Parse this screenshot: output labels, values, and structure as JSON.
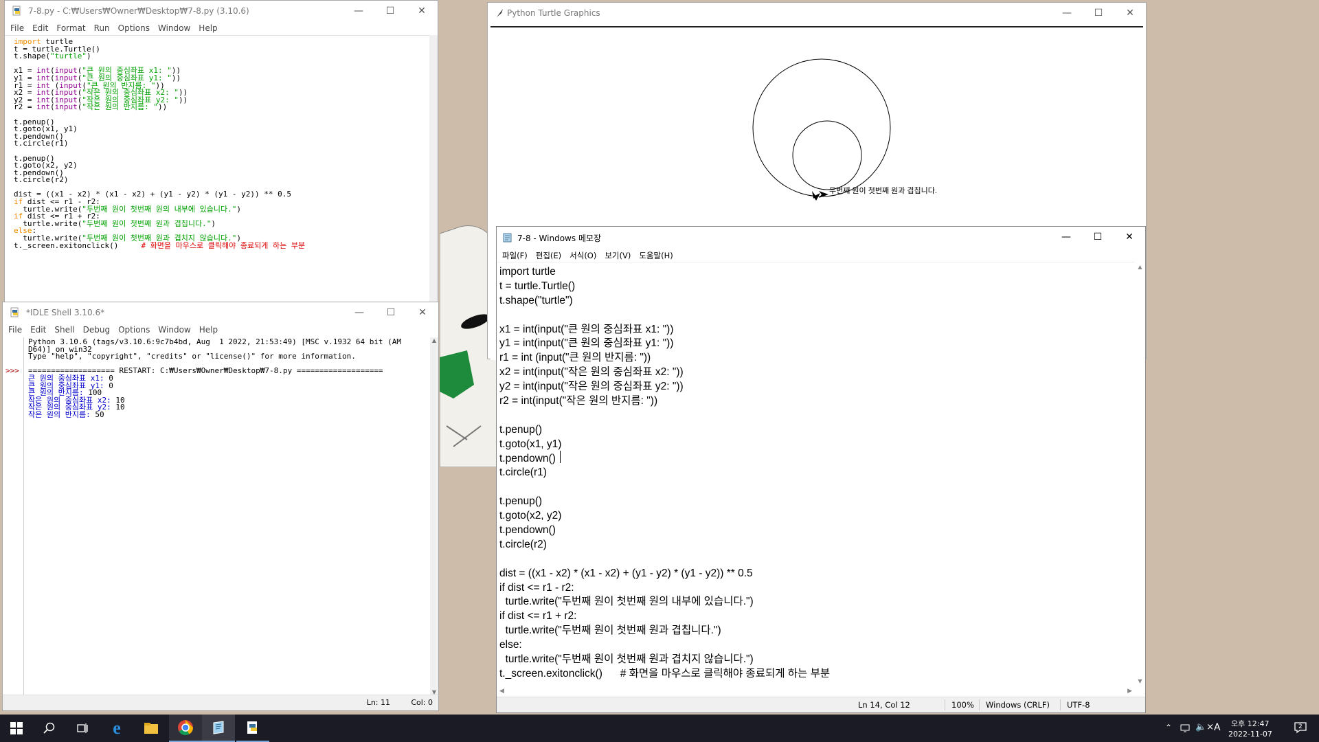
{
  "editor": {
    "title": "7-8.py - C:₩Users₩Owner₩Desktop₩7-8.py (3.10.6)",
    "menu": [
      "File",
      "Edit",
      "Format",
      "Run",
      "Options",
      "Window",
      "Help"
    ],
    "lines": [
      [
        {
          "t": "import",
          "c": "kw"
        },
        {
          "t": " turtle"
        }
      ],
      [
        {
          "t": "t = turtle.Turtle()"
        }
      ],
      [
        {
          "t": "t.shape("
        },
        {
          "t": "\"turtle\"",
          "c": "st"
        },
        {
          "t": ")"
        }
      ],
      [],
      [
        {
          "t": "x1 = "
        },
        {
          "t": "int",
          "c": "bi"
        },
        {
          "t": "("
        },
        {
          "t": "input",
          "c": "bi"
        },
        {
          "t": "("
        },
        {
          "t": "\"큰 원의 중심좌표 x1: \"",
          "c": "st"
        },
        {
          "t": "))"
        }
      ],
      [
        {
          "t": "y1 = "
        },
        {
          "t": "int",
          "c": "bi"
        },
        {
          "t": "("
        },
        {
          "t": "input",
          "c": "bi"
        },
        {
          "t": "("
        },
        {
          "t": "\"큰 원의 중심좌표 y1: \"",
          "c": "st"
        },
        {
          "t": "))"
        }
      ],
      [
        {
          "t": "r1 = "
        },
        {
          "t": "int",
          "c": "bi"
        },
        {
          "t": " ("
        },
        {
          "t": "input",
          "c": "bi"
        },
        {
          "t": "("
        },
        {
          "t": "\"큰 원의 반지름: \"",
          "c": "st"
        },
        {
          "t": "))"
        }
      ],
      [
        {
          "t": "x2 = "
        },
        {
          "t": "int",
          "c": "bi"
        },
        {
          "t": "("
        },
        {
          "t": "input",
          "c": "bi"
        },
        {
          "t": "("
        },
        {
          "t": "\"작은 원의 중심좌표 x2: \"",
          "c": "st"
        },
        {
          "t": "))"
        }
      ],
      [
        {
          "t": "y2 = "
        },
        {
          "t": "int",
          "c": "bi"
        },
        {
          "t": "("
        },
        {
          "t": "input",
          "c": "bi"
        },
        {
          "t": "("
        },
        {
          "t": "\"작은 원의 중심좌표 y2: \"",
          "c": "st"
        },
        {
          "t": "))"
        }
      ],
      [
        {
          "t": "r2 = "
        },
        {
          "t": "int",
          "c": "bi"
        },
        {
          "t": "("
        },
        {
          "t": "input",
          "c": "bi"
        },
        {
          "t": "("
        },
        {
          "t": "\"작은 원의 반지름: \"",
          "c": "st"
        },
        {
          "t": "))"
        }
      ],
      [],
      [
        {
          "t": "t.penup()"
        }
      ],
      [
        {
          "t": "t.goto(x1, y1)"
        }
      ],
      [
        {
          "t": "t.pendown()"
        }
      ],
      [
        {
          "t": "t.circle(r1)"
        }
      ],
      [],
      [
        {
          "t": "t.penup()"
        }
      ],
      [
        {
          "t": "t.goto(x2, y2)"
        }
      ],
      [
        {
          "t": "t.pendown()"
        }
      ],
      [
        {
          "t": "t.circle(r2)"
        }
      ],
      [],
      [
        {
          "t": "dist = ((x1 - x2) * (x1 - x2) + (y1 - y2) * (y1 - y2)) ** 0.5"
        }
      ],
      [
        {
          "t": "if",
          "c": "kw"
        },
        {
          "t": " dist <= r1 - r2:"
        }
      ],
      [
        {
          "t": "  turtle.write("
        },
        {
          "t": "\"두번째 원이 첫번째 원의 내부에 있습니다.\"",
          "c": "st"
        },
        {
          "t": ")"
        }
      ],
      [
        {
          "t": "if",
          "c": "kw"
        },
        {
          "t": " dist <= r1 + r2:"
        }
      ],
      [
        {
          "t": "  turtle.write("
        },
        {
          "t": "\"두번째 원이 첫번째 원과 겹칩니다.\"",
          "c": "st"
        },
        {
          "t": ")"
        }
      ],
      [
        {
          "t": "else",
          "c": "kw"
        },
        {
          "t": ":"
        }
      ],
      [
        {
          "t": "  turtle.write("
        },
        {
          "t": "\"두번째 원이 첫번째 원과 겹치지 않습니다.\"",
          "c": "st"
        },
        {
          "t": ")"
        }
      ],
      [
        {
          "t": "t._screen.exitonclick()     "
        },
        {
          "t": "# 화면을 마우스로 클릭해야 종료되게 하는 부분",
          "c": "cm"
        }
      ]
    ]
  },
  "shell": {
    "title": "*IDLE Shell 3.10.6*",
    "menu": [
      "File",
      "Edit",
      "Shell",
      "Debug",
      "Options",
      "Window",
      "Help"
    ],
    "prompt": ">>>",
    "lines": [
      [
        {
          "t": "Python 3.10.6 (tags/v3.10.6:9c7b4bd, Aug  1 2022, 21:53:49) [MSC v.1932 64 bit (AM"
        }
      ],
      [
        {
          "t": "D64)] on win32"
        }
      ],
      [
        {
          "t": "Type \"help\", \"copyright\", \"credits\" or \"license()\" for more information."
        }
      ],
      [],
      [
        {
          "t": "=================== RESTART: C:₩Users₩Owner₩Desktop₩7-8.py ==================="
        }
      ],
      [
        {
          "t": "큰 원의 중심좌표 x1: ",
          "c": "blue"
        },
        {
          "t": "0"
        }
      ],
      [
        {
          "t": "큰 원의 중심좌표 y1: ",
          "c": "blue"
        },
        {
          "t": "0"
        }
      ],
      [
        {
          "t": "큰 원의 반지름: ",
          "c": "blue"
        },
        {
          "t": "100"
        }
      ],
      [
        {
          "t": "작은 원의 중심좌표 x2: ",
          "c": "blue"
        },
        {
          "t": "10"
        }
      ],
      [
        {
          "t": "작은 원의 중심좌표 y2: ",
          "c": "blue"
        },
        {
          "t": "10"
        }
      ],
      [
        {
          "t": "작은 원의 반지름: ",
          "c": "blue"
        },
        {
          "t": "50"
        }
      ]
    ],
    "status_ln": "Ln: 11",
    "status_col": "Col: 0"
  },
  "turtle": {
    "title": "Python Turtle Graphics",
    "text": "두번째 원이 첫번째 원과 겹칩니다."
  },
  "notepad": {
    "title": "7-8 - Windows 메모장",
    "menu": [
      "파일(F)",
      "편집(E)",
      "서식(O)",
      "보기(V)",
      "도움말(H)"
    ],
    "lines": [
      "import turtle",
      "t = turtle.Turtle()",
      "t.shape(\"turtle\")",
      "",
      "x1 = int(input(\"큰 원의 중심좌표 x1: \"))",
      "y1 = int(input(\"큰 원의 중심좌표 y1: \"))",
      "r1 = int (input(\"큰 원의 반지름: \"))",
      "x2 = int(input(\"작은 원의 중심좌표 x2: \"))",
      "y2 = int(input(\"작은 원의 중심좌표 y2: \"))",
      "r2 = int(input(\"작은 원의 반지름: \"))",
      "",
      "t.penup()",
      "t.goto(x1, y1)",
      "t.pendown()",
      "t.circle(r1)",
      "",
      "t.penup()",
      "t.goto(x2, y2)",
      "t.pendown()",
      "t.circle(r2)",
      "",
      "dist = ((x1 - x2) * (x1 - x2) + (y1 - y2) * (y1 - y2)) ** 0.5",
      "if dist <= r1 - r2:",
      "  turtle.write(\"두번째 원이 첫번째 원의 내부에 있습니다.\")",
      "if dist <= r1 + r2:",
      "  turtle.write(\"두번째 원이 첫번째 원과 겹칩니다.\")",
      "else:",
      "  turtle.write(\"두번째 원이 첫번째 원과 겹치지 않습니다.\")",
      "t._screen.exitonclick()      # 화면을 마우스로 클릭해야 종료되게 하는 부분"
    ],
    "status": {
      "pos": "Ln 14, Col 12",
      "zoom": "100%",
      "eol": "Windows (CRLF)",
      "enc": "UTF-8"
    }
  },
  "taskbar": {
    "icons": [
      "windows-start-icon",
      "search-icon",
      "task-view-icon",
      "internet-explorer-icon",
      "file-explorer-icon",
      "chrome-icon",
      "notepad-icon",
      "idle-python-icon"
    ],
    "time": "오후 12:47",
    "date": "2022-11-07",
    "ime": "A",
    "notification_count": "2"
  },
  "colors": {
    "taskbar": "#1a1b24",
    "desktop": "#cdbcaa",
    "idle_keyword": "#f08c00",
    "idle_builtin": "#900090",
    "idle_string": "#00a000",
    "idle_comment": "#dd0000"
  }
}
